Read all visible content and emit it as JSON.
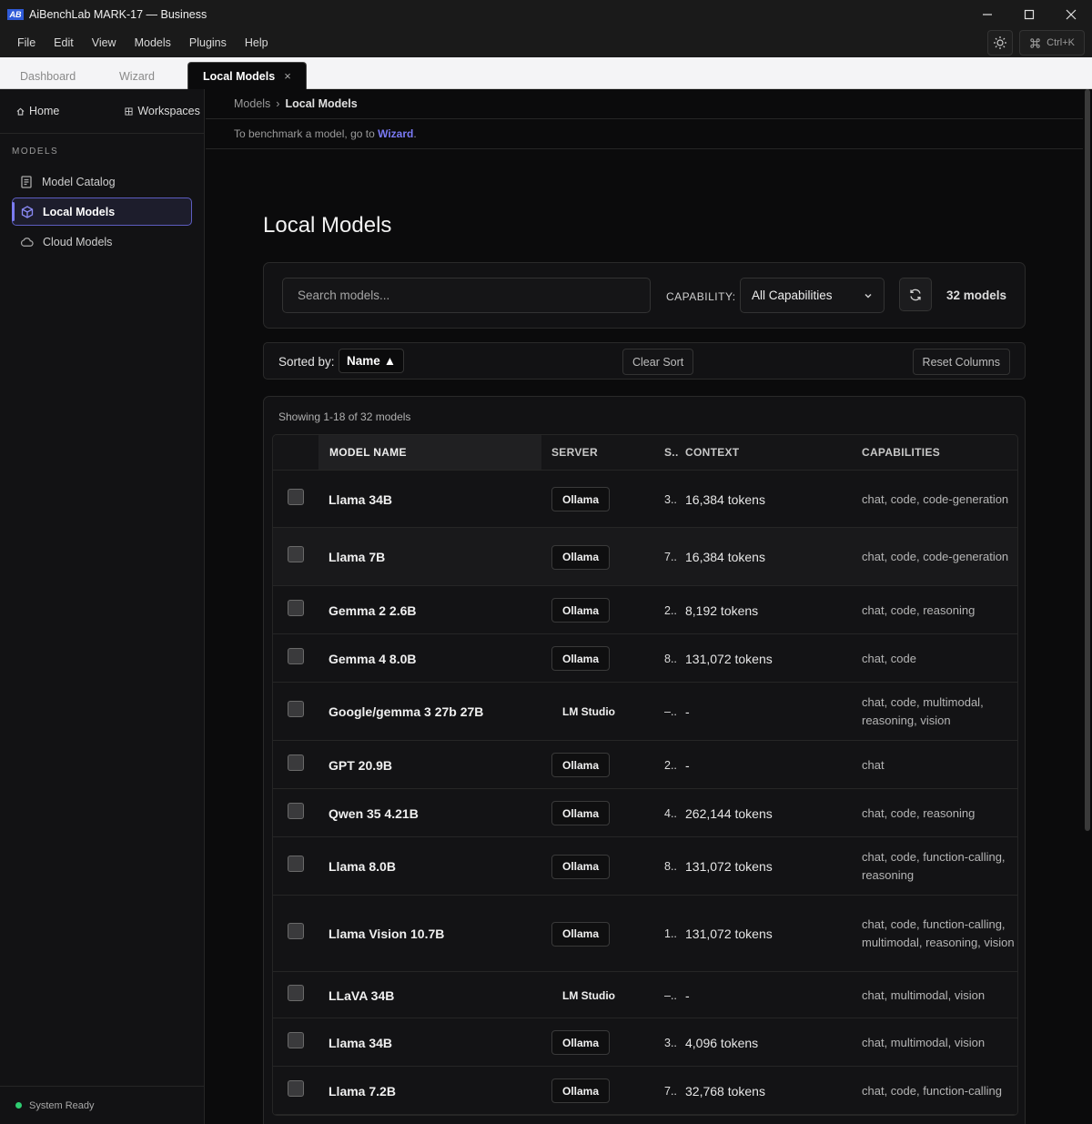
{
  "window": {
    "logo": "AB",
    "title": "AiBenchLab MARK-17 — Business"
  },
  "menu": [
    "File",
    "Edit",
    "View",
    "Models",
    "Plugins",
    "Help"
  ],
  "shortcut": "Ctrl+K",
  "tabs": [
    {
      "label": "Dashboard",
      "active": false
    },
    {
      "label": "Wizard",
      "active": false
    },
    {
      "label": "Local Models",
      "active": true,
      "close": "×"
    }
  ],
  "sidebar": {
    "home": "Home",
    "workspaces": "Workspaces",
    "section": "MODELS",
    "items": [
      {
        "label": "Model Catalog",
        "icon": "catalog-icon",
        "active": false
      },
      {
        "label": "Local Models",
        "icon": "cube-icon",
        "active": true
      },
      {
        "label": "Cloud Models",
        "icon": "cloud-icon",
        "active": false
      }
    ],
    "status": "System Ready"
  },
  "breadcrumb": {
    "parent": "Models",
    "separator": "›",
    "current": "Local Models"
  },
  "notice": {
    "prefix": "To benchmark a model, go to ",
    "link": "Wizard",
    "suffix": "."
  },
  "page_title": "Local Models",
  "filters": {
    "search_placeholder": "Search models...",
    "capability_label": "CAPABILITY:",
    "capability_value": "All Capabilities",
    "count": "32 models"
  },
  "sort": {
    "label": "Sorted by:",
    "field": "Name",
    "direction_glyph": "▲",
    "clear": "Clear Sort",
    "reset": "Reset Columns"
  },
  "table": {
    "showing": "Showing 1-18 of 32 models",
    "headers": {
      "name": "MODEL NAME",
      "server": "SERVER",
      "size": "S..",
      "context": "CONTEXT",
      "capabilities": "CAPABILITIES"
    },
    "rows": [
      {
        "name": "Llama 34B",
        "server": "Ollama",
        "badge": true,
        "size": "3..",
        "context": "16,384 tokens",
        "caps": "chat, code, code-generation",
        "h": 63
      },
      {
        "name": "Llama 7B",
        "server": "Ollama",
        "badge": true,
        "size": "7..",
        "context": "16,384 tokens",
        "caps": "chat, code, code-generation",
        "h": 64
      },
      {
        "name": "Gemma 2 2.6B",
        "server": "Ollama",
        "badge": true,
        "size": "2..",
        "context": "8,192 tokens",
        "caps": "chat, code, reasoning",
        "h": 53
      },
      {
        "name": "Gemma 4 8.0B",
        "server": "Ollama",
        "badge": true,
        "size": "8..",
        "context": "131,072 tokens",
        "caps": "chat, code",
        "h": 53
      },
      {
        "name": "Google/gemma 3 27b 27B",
        "server": "LM Studio",
        "badge": false,
        "size": "–..",
        "context": "-",
        "caps": "chat, code, multimodal, reasoning, vision",
        "h": 64
      },
      {
        "name": "GPT 20.9B",
        "server": "Ollama",
        "badge": true,
        "size": "2..",
        "context": "-",
        "caps": "chat",
        "h": 53
      },
      {
        "name": "Qwen 35 4.21B",
        "server": "Ollama",
        "badge": true,
        "size": "4..",
        "context": "262,144 tokens",
        "caps": "chat, code, reasoning",
        "h": 53
      },
      {
        "name": "Llama 8.0B",
        "server": "Ollama",
        "badge": true,
        "size": "8..",
        "context": "131,072 tokens",
        "caps": "chat, code, function-calling, reasoning",
        "h": 64
      },
      {
        "name": "Llama Vision 10.7B",
        "server": "Ollama",
        "badge": true,
        "size": "1..",
        "context": "131,072 tokens",
        "caps": "chat, code, function-calling, multimodal, reasoning, vision",
        "h": 84
      },
      {
        "name": "LLaVA 34B",
        "server": "LM Studio",
        "badge": false,
        "size": "–..",
        "context": "-",
        "caps": "chat, multimodal, vision",
        "h": 51
      },
      {
        "name": "Llama 34B",
        "server": "Ollama",
        "badge": true,
        "size": "3..",
        "context": "4,096 tokens",
        "caps": "chat, multimodal, vision",
        "h": 53
      },
      {
        "name": "Llama 7.2B",
        "server": "Ollama",
        "badge": true,
        "size": "7..",
        "context": "32,768 tokens",
        "caps": "chat, code, function-calling",
        "h": 53
      }
    ]
  }
}
